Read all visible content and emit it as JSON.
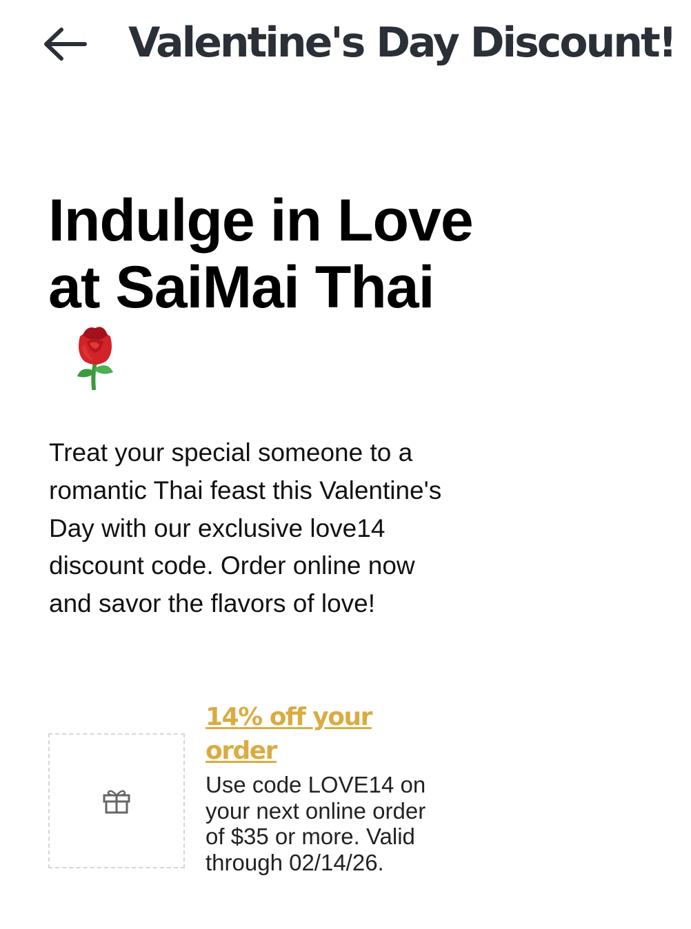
{
  "header": {
    "back_icon": "arrow-left-icon",
    "title": "Valentine's Day Discount!"
  },
  "main": {
    "headline": "Indulge in Love at SaiMai Thai",
    "headline_emoji_icon": "rose-icon",
    "description": "Treat your special someone to a romantic Thai feast this Valentine's Day with our exclusive love14 discount code. Order online now and savor the flavors of love!"
  },
  "offer": {
    "image_icon": "gift-icon",
    "title": "14% off your order",
    "description": "Use code LOVE14 on your next online order of $35 or more. Valid through 02/14/26."
  },
  "colors": {
    "title_text": "#2b2f38",
    "offer_link": "#d9ac43",
    "rose_red": "#d2232a",
    "stem_green": "#3c9a3e",
    "placeholder_border": "#d6d6d6",
    "gift_icon": "#666666"
  }
}
